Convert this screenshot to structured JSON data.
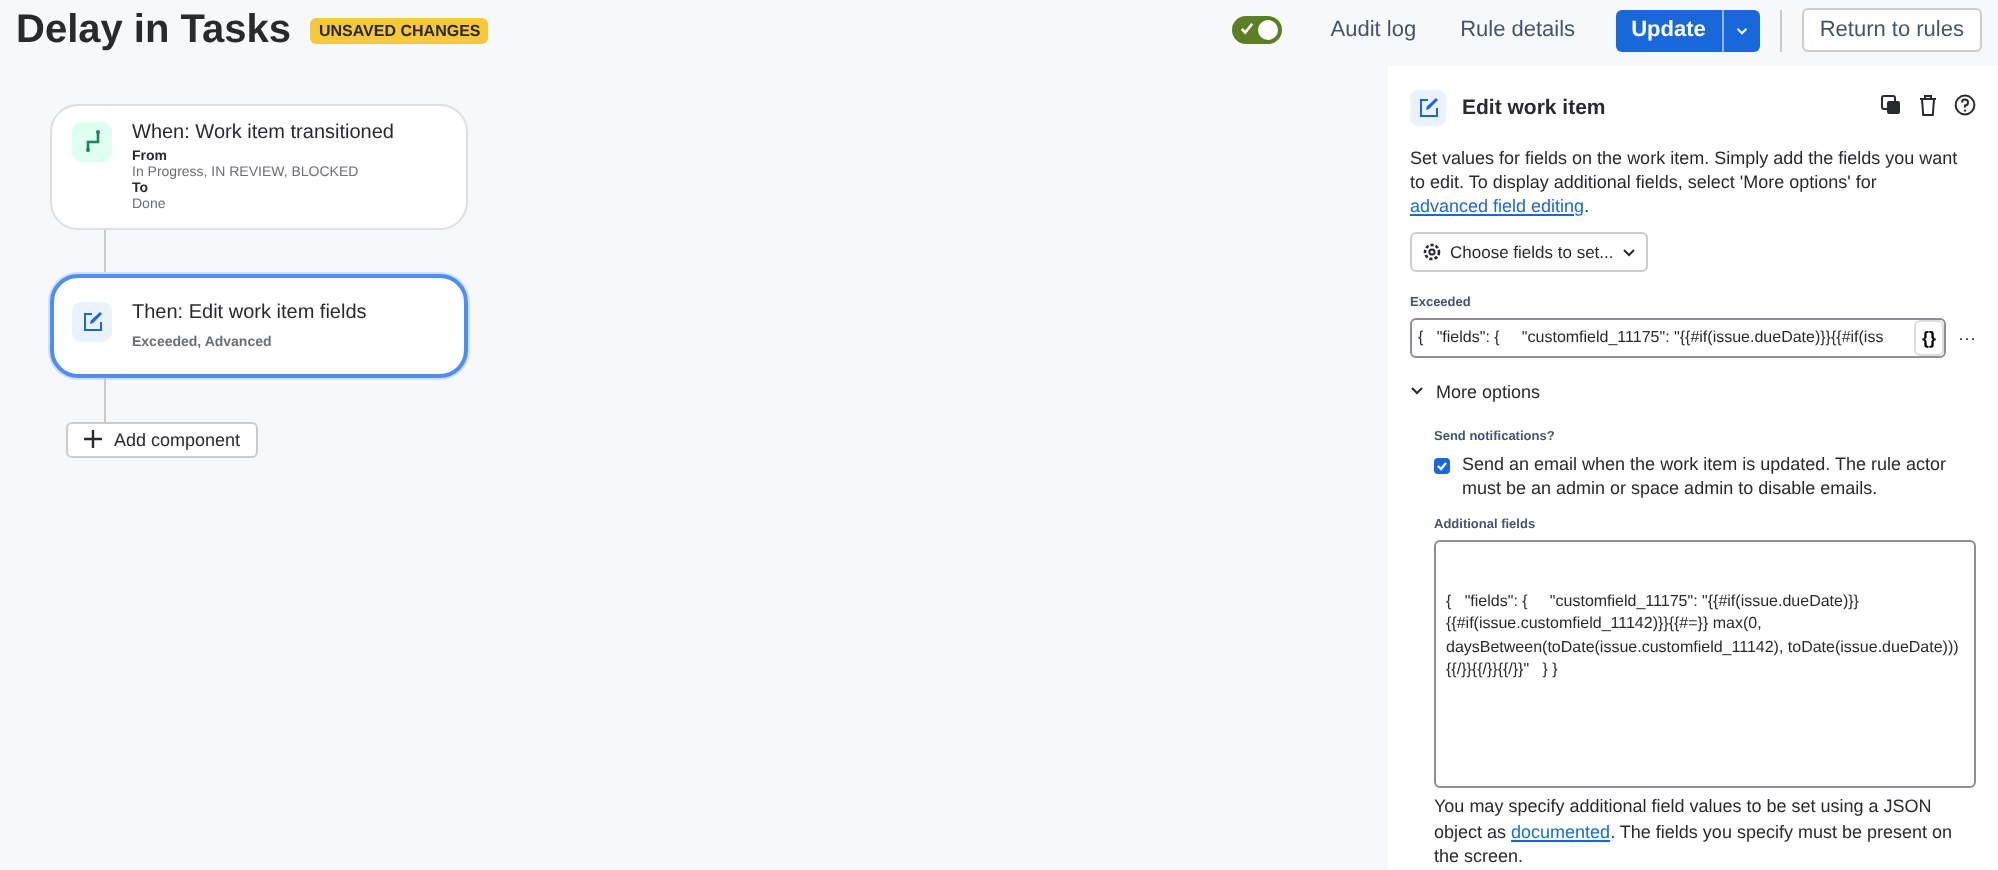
{
  "header": {
    "title": "Delay in Tasks",
    "badge": "UNSAVED CHANGES",
    "rule_enabled": true,
    "links": [
      "Audit log",
      "Rule details"
    ],
    "primary_button": "Update",
    "secondary_button": "Return to rules"
  },
  "flow": {
    "cards": [
      {
        "kind": "trigger",
        "selected": false,
        "title": "When: Work item transitioned",
        "details": [
          {
            "label": "From",
            "value": "In Progress, IN REVIEW, BLOCKED"
          },
          {
            "label": "To",
            "value": "Done"
          }
        ]
      },
      {
        "kind": "action",
        "selected": true,
        "title": "Then: Edit work item fields",
        "subtitle": "Exceeded, Advanced"
      }
    ],
    "add_button": "Add component"
  },
  "panel": {
    "title": "Edit work item",
    "description": "Set values for fields on the work item. Simply add the fields you want to edit. To display additional fields, select 'More options' for ",
    "description_link": "advanced field editing",
    "description_end": ".",
    "choose_button": "Choose fields to set...",
    "field_label": "Exceeded",
    "field_value": "{   \"fields\": {     \"customfield_11175\": \"{{#if(issue.dueDate)}}{{#if(iss",
    "field_button": "{}",
    "field_more": "···",
    "more_options": {
      "label": "More options",
      "expanded": true
    },
    "notifications_label": "Send notifications?",
    "notify": {
      "checked": true,
      "text": "Send an email when the work item is updated. The rule actor must be an admin or space admin to disable emails."
    },
    "additional_label": "Additional fields",
    "additional_value": "{   \"fields\": {     \"customfield_11175\": \"{{#if(issue.dueDate)}}{{#if(issue.customfield_11142)}}{{#=}} max(0, daysBetween(toDate(issue.customfield_11142), toDate(issue.dueDate))){{/}}{{/}}{{/}}\"   } }",
    "help": "You may specify additional field values to be set using a JSON object as ",
    "help_link": "documented",
    "help_end": ". The fields you specify must be present on the screen."
  }
}
